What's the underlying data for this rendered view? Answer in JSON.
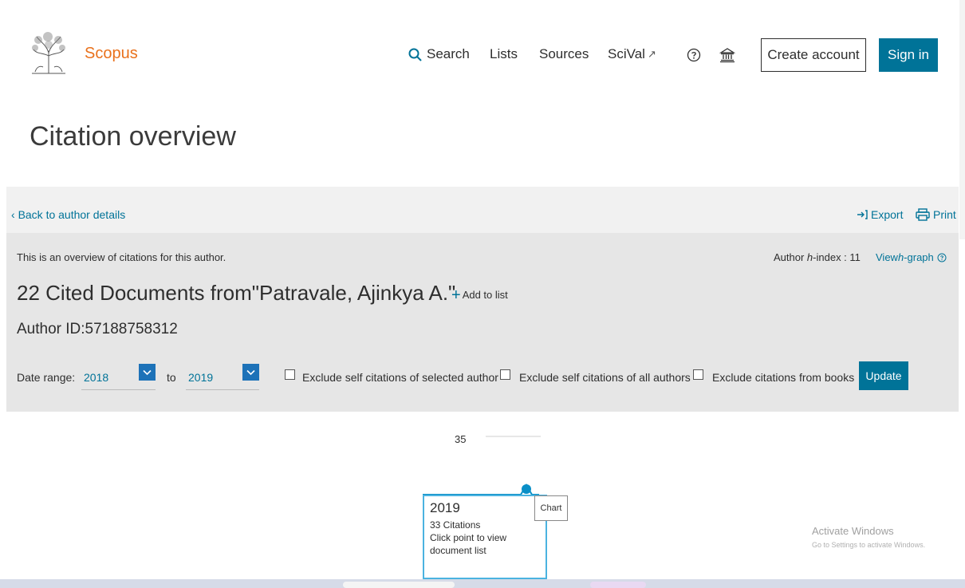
{
  "header": {
    "brand": "Scopus",
    "nav": {
      "search": "Search",
      "lists": "Lists",
      "sources": "Sources",
      "scival": "SciVal",
      "scival_arrow": "↗"
    },
    "create_account": "Create account",
    "sign_in": "Sign in"
  },
  "page": {
    "title": "Citation overview"
  },
  "toolbar": {
    "back": "Back to author details",
    "export": "Export",
    "print": "Print"
  },
  "overview": {
    "intro": "This is an overview of citations for this author.",
    "hindex_label_pre": "Author ",
    "hindex_label_h": "h",
    "hindex_label_post": "-index : 11",
    "view_hgraph_pre": "View ",
    "view_hgraph_h": "h",
    "view_hgraph_post": "-graph",
    "cited_title": "22 Cited Documents from\"Patravale, Ajinkya A.\"",
    "add_to_list": "Add to list",
    "author_id": "Author ID:57188758312"
  },
  "filters": {
    "date_range_label": "Date range:",
    "from": "2018",
    "to_label": "to",
    "to": "2019",
    "checkboxes": [
      {
        "label": "Exclude self citations of selected author",
        "checked": false
      },
      {
        "label": "Exclude self citations of all authors",
        "checked": false
      },
      {
        "label": "Exclude citations from books",
        "checked": false
      }
    ],
    "update": "Update"
  },
  "chart_data": {
    "type": "line",
    "x": [
      "2019"
    ],
    "series": [
      {
        "values": [
          33
        ]
      }
    ],
    "ytick_labels": [
      "35"
    ],
    "tooltip": {
      "year": "2019",
      "citations": "33 Citations",
      "hint": "Click point to view document list"
    },
    "context_tip": "Chart"
  },
  "watermark": {
    "title": "Activate Windows",
    "subtitle": "Go to Settings to activate Windows."
  },
  "colors": {
    "brand": "#e9711c",
    "primary": "#007398",
    "chart_line": "#0a8fc7"
  }
}
